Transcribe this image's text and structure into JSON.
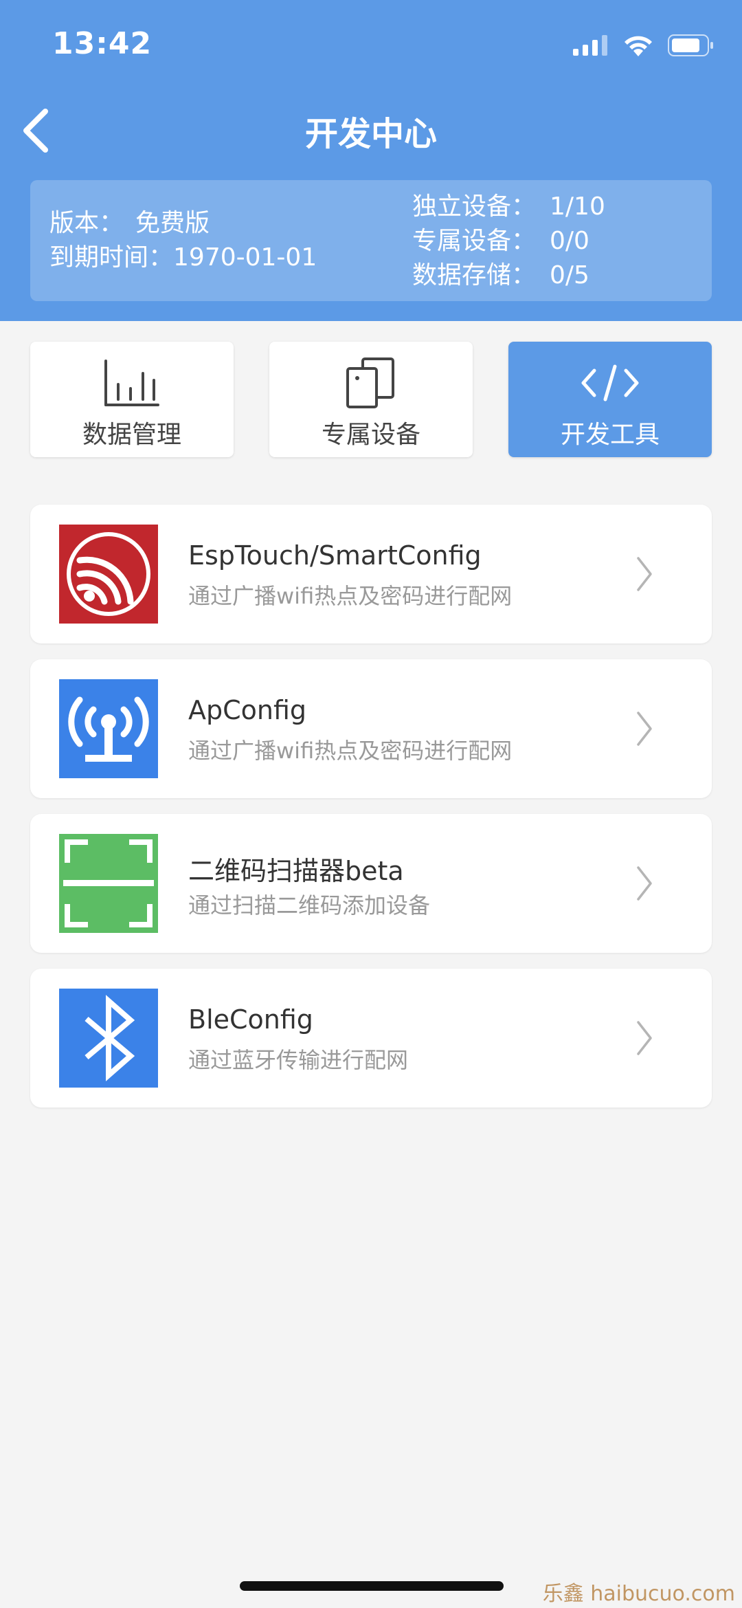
{
  "status": {
    "time": "13:42"
  },
  "header": {
    "title": "开发中心"
  },
  "info": {
    "version_label": "版本：",
    "version_value": "免费版",
    "expire_label": "到期时间：",
    "expire_value": "1970-01-01",
    "standalone_label": "独立设备：",
    "standalone_value": "1/10",
    "exclusive_label": "专属设备：",
    "exclusive_value": "0/0",
    "storage_label": "数据存储：",
    "storage_value": "0/5"
  },
  "tabs": [
    {
      "label": "数据管理",
      "icon": "bar-chart-icon",
      "active": false
    },
    {
      "label": "专属设备",
      "icon": "devices-icon",
      "active": false
    },
    {
      "label": "开发工具",
      "icon": "code-icon",
      "active": true
    }
  ],
  "tools": [
    {
      "title": "EspTouch/SmartConfig",
      "subtitle": "通过广播wifi热点及密码进行配网",
      "icon": "espressif-logo-icon",
      "color": "#c1272d"
    },
    {
      "title": "ApConfig",
      "subtitle": "通过广播wifi热点及密码进行配网",
      "icon": "antenna-icon",
      "color": "#3b82e8"
    },
    {
      "title": "二维码扫描器beta",
      "subtitle": "通过扫描二维码添加设备",
      "icon": "qr-scan-icon",
      "color": "#5cbd64"
    },
    {
      "title": "BleConfig",
      "subtitle": "通过蓝牙传输进行配网",
      "icon": "bluetooth-icon",
      "color": "#3b82e8"
    }
  ],
  "watermark": "乐鑫 haibucuo.com"
}
